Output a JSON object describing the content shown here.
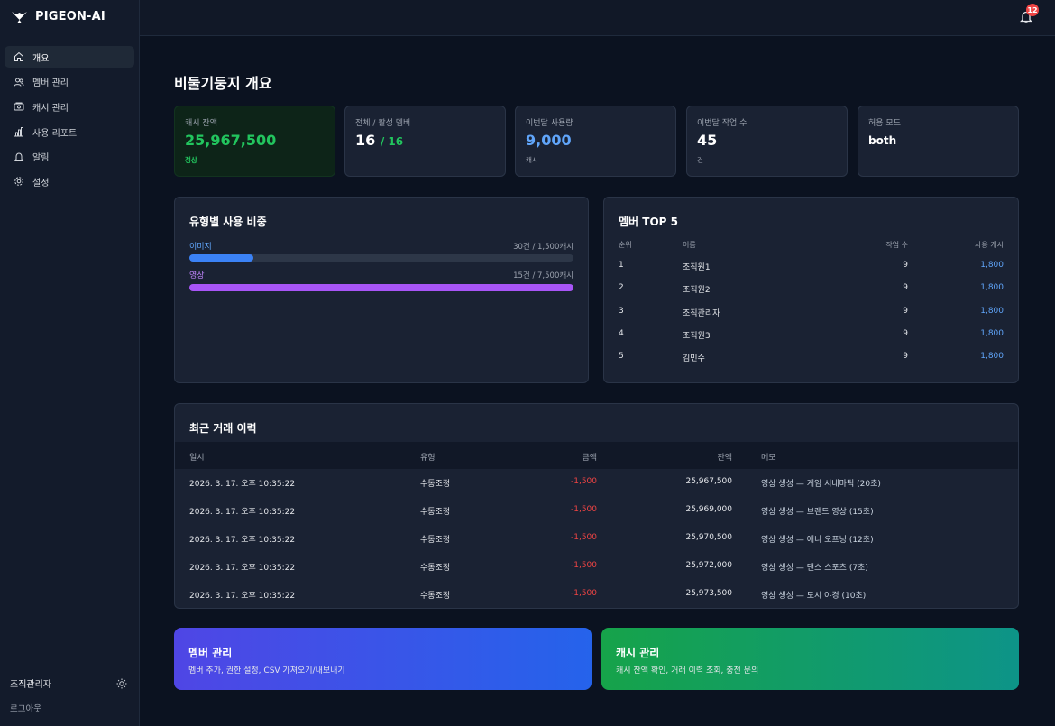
{
  "brand": {
    "name": "PIGEON-AI"
  },
  "sidebar": {
    "items": [
      {
        "label": "개요",
        "icon": "home-icon",
        "active": true
      },
      {
        "label": "멤버 관리",
        "icon": "users-icon"
      },
      {
        "label": "캐시 관리",
        "icon": "wallet-icon"
      },
      {
        "label": "사용 리포트",
        "icon": "bar-chart-icon"
      },
      {
        "label": "알림",
        "icon": "bell-icon"
      },
      {
        "label": "설정",
        "icon": "gear-icon"
      }
    ],
    "user_name": "조직관리자",
    "logout_label": "로그아웃"
  },
  "topbar": {
    "notification_count": "12"
  },
  "page": {
    "title": "비둘기둥지 개요"
  },
  "stats": [
    {
      "label": "캐시 잔액",
      "value": "25,967,500",
      "sub": "정상",
      "value_color": "#22c55e",
      "sub_color": "#22c55e"
    },
    {
      "label": "전체 / 활성 멤버",
      "value": "16",
      "value_extra": "/ 16",
      "value_color": "#ffffff",
      "extra_color": "#22c55e"
    },
    {
      "label": "이번달 사용량",
      "value": "9,000",
      "sub": "캐시",
      "value_color": "#60a5fa"
    },
    {
      "label": "이번달 작업 수",
      "value": "45",
      "sub": "건",
      "value_color": "#ffffff"
    },
    {
      "label": "허용 모드",
      "value": "both",
      "value_color": "#ffffff"
    }
  ],
  "usage": {
    "title": "유형별 사용 비중",
    "items": [
      {
        "label": "이미지",
        "info": "30건 / 1,500캐시",
        "fraction": 0.1667,
        "color": "#3b82f6"
      },
      {
        "label": "영상",
        "info": "15건 / 7,500캐시",
        "fraction": 1.0,
        "color": "#a855f7"
      }
    ]
  },
  "top_members": {
    "title": "멤버 TOP 5",
    "headers": {
      "rank": "순위",
      "name": "이름",
      "jobs": "작업 수",
      "cash": "사용 캐시"
    },
    "rows": [
      {
        "rank": "1",
        "name": "조직원1",
        "jobs": "9",
        "cash": "1,800"
      },
      {
        "rank": "2",
        "name": "조직원2",
        "jobs": "9",
        "cash": "1,800"
      },
      {
        "rank": "3",
        "name": "조직관리자",
        "jobs": "9",
        "cash": "1,800"
      },
      {
        "rank": "4",
        "name": "조직원3",
        "jobs": "9",
        "cash": "1,800"
      },
      {
        "rank": "5",
        "name": "김민수",
        "jobs": "9",
        "cash": "1,800"
      }
    ]
  },
  "transactions": {
    "title": "최근 거래 이력",
    "headers": {
      "date": "일시",
      "type": "유형",
      "amount": "금액",
      "balance": "잔액",
      "memo": "메모"
    },
    "rows": [
      {
        "date": "2026. 3. 17. 오후 10:35:22",
        "type": "수동조정",
        "amount": "-1,500",
        "balance": "25,967,500",
        "memo": "영상 생성 — 게임 시네마틱 (20초)"
      },
      {
        "date": "2026. 3. 17. 오후 10:35:22",
        "type": "수동조정",
        "amount": "-1,500",
        "balance": "25,969,000",
        "memo": "영상 생성 — 브랜드 영상 (15초)"
      },
      {
        "date": "2026. 3. 17. 오후 10:35:22",
        "type": "수동조정",
        "amount": "-1,500",
        "balance": "25,970,500",
        "memo": "영상 생성 — 애니 오프닝 (12초)"
      },
      {
        "date": "2026. 3. 17. 오후 10:35:22",
        "type": "수동조정",
        "amount": "-1,500",
        "balance": "25,972,000",
        "memo": "영상 생성 — 댄스 스포츠 (7초)"
      },
      {
        "date": "2026. 3. 17. 오후 10:35:22",
        "type": "수동조정",
        "amount": "-1,500",
        "balance": "25,973,500",
        "memo": "영상 생성 — 도시 야경 (10초)"
      }
    ]
  },
  "actions": [
    {
      "title": "멤버 관리",
      "desc": "멤버 추가, 권한 설정, CSV 가져오기/내보내기",
      "gradient": [
        "#4f46e5",
        "#2563eb"
      ]
    },
    {
      "title": "캐시 관리",
      "desc": "캐시 잔액 확인, 거래 이력 조회, 충전 문의",
      "gradient": [
        "#16a34a",
        "#0d9488"
      ]
    }
  ],
  "colors": {
    "negative": "#ef4444",
    "accent_blue": "#60a5fa",
    "purple": "#a855f7"
  }
}
